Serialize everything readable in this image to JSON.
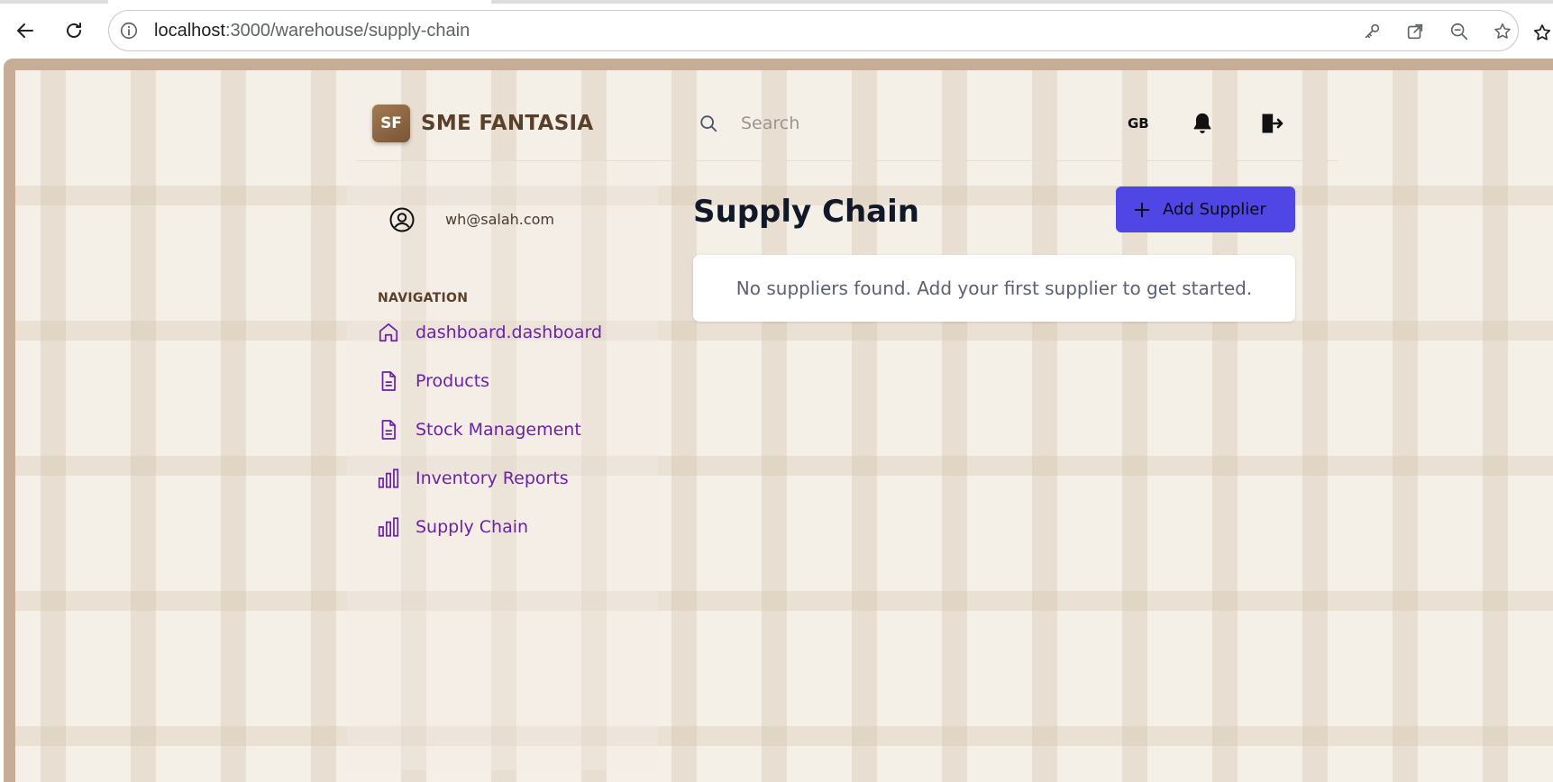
{
  "browser": {
    "url_host": "localhost",
    "url_path": ":3000/warehouse/supply-chain"
  },
  "header": {
    "logo_initials": "SF",
    "brand_name": "SME FANTASIA",
    "search_placeholder": "Search",
    "search_value": "",
    "language": "GB"
  },
  "user": {
    "email": "wh@salah.com"
  },
  "sidebar": {
    "heading": "NAVIGATION",
    "items": [
      {
        "label": "dashboard.dashboard",
        "icon": "home-icon"
      },
      {
        "label": "Products",
        "icon": "document-icon"
      },
      {
        "label": "Stock Management",
        "icon": "document-icon"
      },
      {
        "label": "Inventory Reports",
        "icon": "bar-chart-icon"
      },
      {
        "label": "Supply Chain",
        "icon": "bar-chart-icon"
      }
    ]
  },
  "main": {
    "title": "Supply Chain",
    "add_button_label": "Add Supplier",
    "empty_message": "No suppliers found. Add your first supplier to get started."
  },
  "colors": {
    "accent": "#4f46e5",
    "nav_text": "#6b21a8",
    "brand": "#5a3f2b",
    "background": "#f4efe7",
    "frame": "#c8ad96"
  }
}
